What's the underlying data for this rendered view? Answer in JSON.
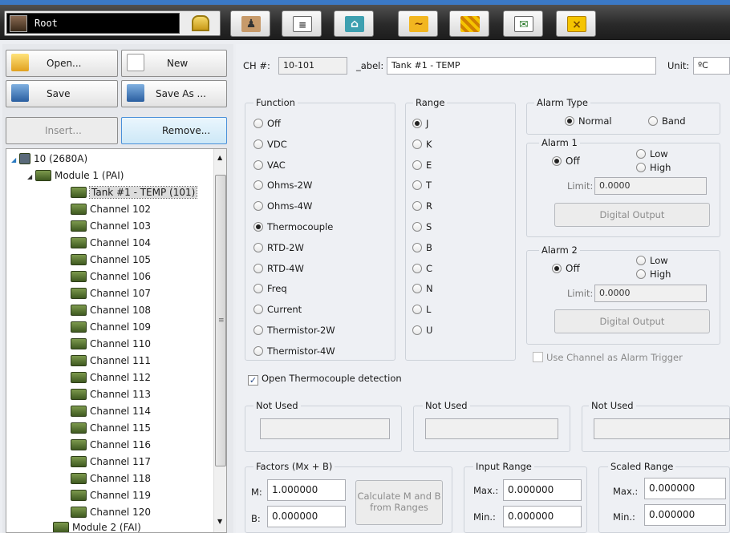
{
  "user": {
    "name": "Root"
  },
  "toolbar": {
    "icons": [
      "lock-icon",
      "user-lock-icon",
      "list-icon",
      "network-icon",
      "chart-icon",
      "alarm-icon",
      "mail-forward-icon",
      "close-icon"
    ]
  },
  "file": {
    "open": "Open...",
    "new": "New",
    "save": "Save",
    "save_as": "Save As ...",
    "insert": "Insert...",
    "remove": "Remove..."
  },
  "tree": {
    "root": "10 (2680A)",
    "module1": "Module 1 (PAI)",
    "selected": "Tank #1 - TEMP (101)",
    "channels": [
      "Channel 102",
      "Channel 103",
      "Channel 104",
      "Channel 105",
      "Channel 106",
      "Channel 107",
      "Channel 108",
      "Channel 109",
      "Channel 110",
      "Channel 111",
      "Channel 112",
      "Channel 113",
      "Channel 114",
      "Channel 115",
      "Channel 116",
      "Channel 117",
      "Channel 118",
      "Channel 119",
      "Channel 120"
    ],
    "module2": "Module 2 (FAI)"
  },
  "header": {
    "ch_label": "CH #:",
    "ch_value": "10-101",
    "label_label": "_abel:",
    "label_value": "Tank #1 - TEMP",
    "unit_label": "Unit:",
    "unit_value": "ºC"
  },
  "function": {
    "title": "Function",
    "options": [
      "Off",
      "VDC",
      "VAC",
      "Ohms-2W",
      "Ohms-4W",
      "Thermocouple",
      "RTD-2W",
      "RTD-4W",
      "Freq",
      "Current",
      "Thermistor-2W",
      "Thermistor-4W"
    ],
    "selected": "Thermocouple"
  },
  "range": {
    "title": "Range",
    "options": [
      "J",
      "K",
      "E",
      "T",
      "R",
      "S",
      "B",
      "C",
      "N",
      "L",
      "U"
    ],
    "selected": "J"
  },
  "alarm_type": {
    "title": "Alarm Type",
    "normal": "Normal",
    "band": "Band",
    "selected": "Normal"
  },
  "alarm1": {
    "title": "Alarm 1",
    "off": "Off",
    "low": "Low",
    "high": "High",
    "limit_label": "Limit:",
    "limit": "0.0000",
    "digital_output": "Digital Output"
  },
  "alarm2": {
    "title": "Alarm 2",
    "off": "Off",
    "low": "Low",
    "high": "High",
    "limit_label": "Limit:",
    "limit": "0.0000",
    "digital_output": "Digital Output"
  },
  "use_alarm_trigger": "Use Channel as Alarm Trigger",
  "open_tc": "Open Thermocouple detection",
  "not_used": [
    "Not Used",
    "Not Used",
    "Not Used"
  ],
  "factors": {
    "title": "Factors (Mx + B)",
    "m_label": "M:",
    "m": "1.000000",
    "b_label": "B:",
    "b": "0.000000",
    "calc": "Calculate M and B from Ranges"
  },
  "input_range": {
    "title": "Input Range",
    "max_label": "Max.:",
    "max": "0.000000",
    "min_label": "Min.:",
    "min": "0.000000"
  },
  "scaled_range": {
    "title": "Scaled Range",
    "max_label": "Max.:",
    "max": "0.000000",
    "min_label": "Min.:",
    "min": "0.000000"
  }
}
